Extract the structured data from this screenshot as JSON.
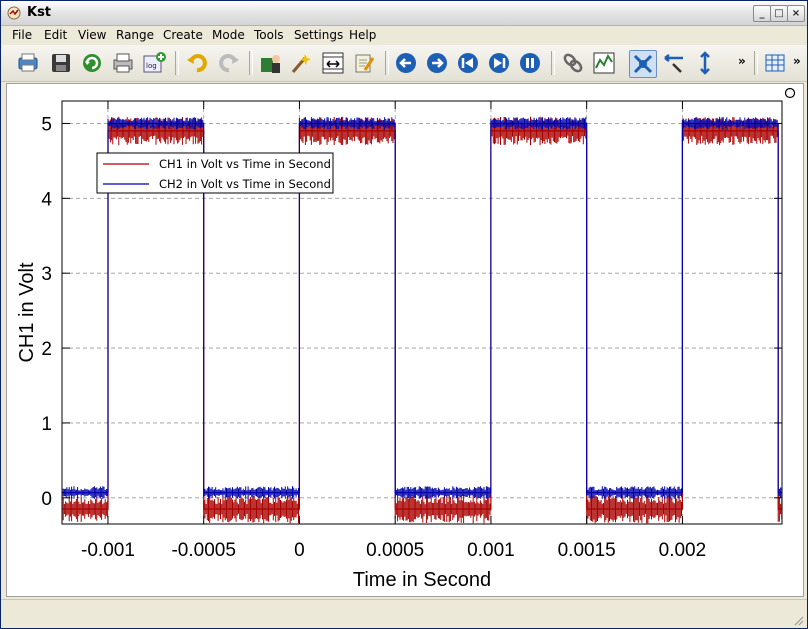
{
  "window": {
    "title": "Kst"
  },
  "menu": [
    "File",
    "Edit",
    "View",
    "Range",
    "Create",
    "Mode",
    "Tools",
    "Settings",
    "Help"
  ],
  "toolbar": {
    "buttons": [
      "print-icon",
      "save-icon",
      "reload-icon",
      "printer-icon",
      "log-icon",
      "undo-icon",
      "redo-icon",
      "data-manager-icon",
      "data-wizard-icon",
      "plot-wizard-icon",
      "edit-icon",
      "back-icon",
      "forward-icon",
      "previous-icon",
      "next-icon",
      "pause-icon",
      "link-icon",
      "chart-icon",
      "zoom-mode-icon",
      "layout-icon",
      "pan-icon",
      "table-icon"
    ],
    "overflow_label": "»"
  },
  "colors": {
    "ch1": "#aa0000",
    "ch2": "#0000aa",
    "grid": "#9a9a9a"
  },
  "chart_data": {
    "type": "line",
    "xlabel": "Time in Second",
    "ylabel": "CH1 in Volt",
    "xlim": [
      -0.00124,
      0.00252
    ],
    "ylim": [
      -0.35,
      5.3
    ],
    "xticks": [
      -0.001,
      -0.0005,
      0,
      0.0005,
      0.001,
      0.0015,
      0.002
    ],
    "xtick_labels": [
      "-0.001",
      "-0.0005",
      "0",
      "0.0005",
      "0.001",
      "0.0015",
      "0.002"
    ],
    "yticks": [
      0,
      1,
      2,
      3,
      4,
      5
    ],
    "ytick_labels": [
      "0",
      "1",
      "2",
      "3",
      "4",
      "5"
    ],
    "grid": true,
    "legend_position": "upper-left",
    "series": [
      {
        "name": "CH1 in Volt vs Time in Second",
        "color": "#aa0000",
        "x": [
          -0.00124,
          -0.001,
          -0.001,
          -0.0005,
          -0.0005,
          0.0,
          0.0,
          0.0005,
          0.0005,
          0.001,
          0.001,
          0.0015,
          0.0015,
          0.002,
          0.002,
          0.0025,
          0.0025,
          0.00252
        ],
        "y": [
          -0.15,
          -0.15,
          4.9,
          4.9,
          -0.15,
          -0.15,
          4.9,
          4.9,
          -0.15,
          -0.15,
          4.9,
          4.9,
          -0.15,
          -0.15,
          4.9,
          4.9,
          -0.15,
          -0.15
        ]
      },
      {
        "name": "CH2 in Volt vs Time in Second",
        "color": "#0000aa",
        "x": [
          -0.00124,
          -0.001,
          -0.001,
          -0.0005,
          -0.0005,
          0.0,
          0.0,
          0.0005,
          0.0005,
          0.001,
          0.001,
          0.0015,
          0.0015,
          0.002,
          0.002,
          0.0025,
          0.0025,
          0.00252
        ],
        "y": [
          0.07,
          0.07,
          5.0,
          5.0,
          0.07,
          0.07,
          5.0,
          5.0,
          0.07,
          0.07,
          5.0,
          5.0,
          0.07,
          0.07,
          5.0,
          5.0,
          0.07,
          0.07
        ]
      }
    ]
  }
}
